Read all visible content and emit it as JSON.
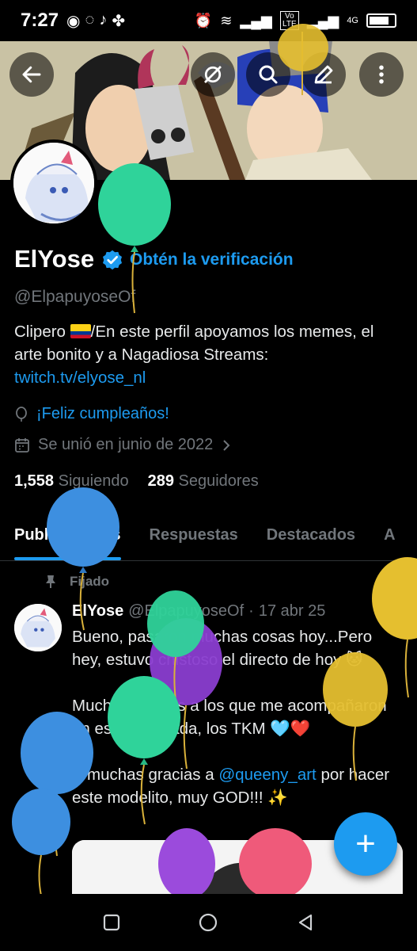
{
  "status_bar": {
    "time": "7:27",
    "network": "4G",
    "volte_label": "Vo LTE"
  },
  "toolbar": {
    "back_icon": "arrow-left-icon",
    "icons": [
      "antenna-off-icon",
      "search-icon",
      "edit-icon",
      "more-vertical-icon"
    ]
  },
  "profile": {
    "name": "ElYose",
    "verified_icon": "verified-badge-icon",
    "get_verified": "Obtén la verificación",
    "handle": "@ElpapuyoseOf",
    "bio_part1": "Clipero ",
    "bio_part2": "/En este perfil apoyamos los memes, el arte bonito y a Nagadiosa  Streams: ",
    "bio_link": "twitch.tv/elyose_nl",
    "birthday": "¡Feliz cumpleaños!",
    "joined": "Se unió en junio de 2022",
    "following_count": "1,558",
    "following_label": "Siguiendo",
    "followers_count": "289",
    "followers_label": "Seguidores"
  },
  "tabs": [
    {
      "label": "Publicaciones",
      "active": true
    },
    {
      "label": "Respuestas",
      "active": false
    },
    {
      "label": "Destacados",
      "active": false
    },
    {
      "label": "A",
      "active": false
    }
  ],
  "post": {
    "pinned_label": "Fijado",
    "author": "ElYose",
    "handle": "@ElpapuyoseOf",
    "separator": "·",
    "date": "17 abr 25",
    "text1": "Bueno, pasaron muchas cosas hoy...Pero hey, estuvo chistoso el directo de hoy 🐱",
    "text2": "Muchas gracias a los que me acompañaron en esta mafufada, los TKM 🩵❤️",
    "text3_pre": "Y muchas gracias a ",
    "text3_link": "@queeny_art",
    "text3_post": " por hacer este modelito, muy GOD!!! ✨"
  },
  "fab_label": "+",
  "colors": {
    "accent": "#1d9bf0",
    "background": "#000000",
    "muted": "#71767b"
  }
}
